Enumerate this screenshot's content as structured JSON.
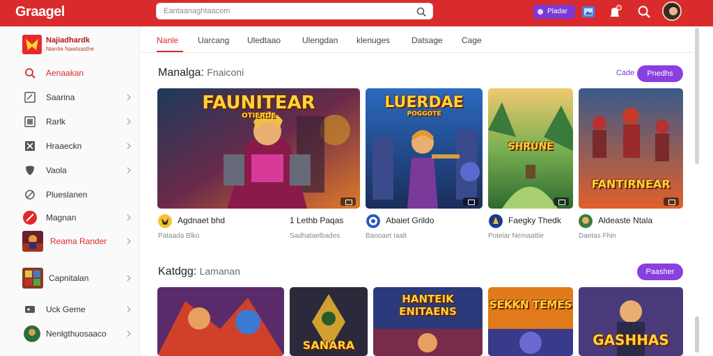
{
  "app": {
    "logo": "Graagel"
  },
  "search": {
    "text": "Eantaanaghtaacom"
  },
  "header": {
    "pill_label": "Pladar"
  },
  "sidebar": {
    "brand_title": "Najiadhardk",
    "brand_sub": "Niantie Nawtsasthe",
    "items": [
      {
        "label": "Aenaakan"
      },
      {
        "label": "Saarina"
      },
      {
        "label": "Rarlk"
      },
      {
        "label": "Hraaeckn"
      },
      {
        "label": "Vaola"
      },
      {
        "label": "Plueslanen"
      },
      {
        "label": "Magnan"
      },
      {
        "label": "Reama Rander"
      },
      {
        "label": "Capnitalan"
      },
      {
        "label": "Uck Geme"
      },
      {
        "label": "Nenlgthuosaaco"
      }
    ]
  },
  "tabs": [
    {
      "label": "Nanle"
    },
    {
      "label": "Uarcang"
    },
    {
      "label": "Uledtaao"
    },
    {
      "label": "Ulengdan"
    },
    {
      "label": "klenuges"
    },
    {
      "label": "Datsage"
    },
    {
      "label": "Cage"
    }
  ],
  "section1": {
    "title": "Manalga:",
    "subtitle": "Fnaiconi",
    "link": "Cade",
    "button": "Pnedhs",
    "cards": [
      {
        "art": "FAUNITEAR",
        "art_sub": "OTIERDE",
        "title": "Agdnaet bhd",
        "sub": "Pataada Blko"
      },
      {
        "art": "LUERDAE",
        "art_sub": "POGGOTE",
        "title": "Abaiet Grildo",
        "sub": "Banoaet Iaalt"
      },
      {
        "art": "SHRUNE",
        "art_sub": "",
        "title": "Faegky Thedk",
        "sub": "Poteiar Nemaattie"
      },
      {
        "art": "FANTIRNEAR",
        "art_sub": "",
        "title": "Aldeaste Ntala",
        "sub": "Daetas Fhin"
      }
    ],
    "extra_meta": {
      "title": "1 Lethb Paqas",
      "sub": "Sadhataelbades"
    }
  },
  "section2": {
    "title": "Katdgg:",
    "subtitle": "Lamanan",
    "button": "Paasher",
    "cards": [
      {
        "art": ""
      },
      {
        "art": "SANARA"
      },
      {
        "art": "HANTEIK ENITAENS"
      },
      {
        "art": "SEKKN TEMES"
      },
      {
        "art": "GASHHAS"
      }
    ]
  },
  "colors": {
    "brand": "#d92b2b",
    "accent": "#8a3fe0"
  }
}
